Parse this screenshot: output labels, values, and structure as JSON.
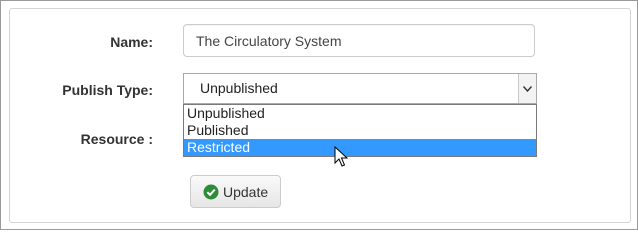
{
  "form": {
    "name_label": "Name:",
    "name_value": "The Circulatory System",
    "publish_type_label": "Publish Type:",
    "publish_type_value": "Unpublished",
    "resource_label": "Resource :",
    "options": [
      "Unpublished",
      "Published",
      "Restricted"
    ],
    "highlighted_option": "Restricted",
    "update_label": "Update"
  },
  "icons": {
    "dropdown_arrow": "chevron-down-icon",
    "update": "check-circle-icon",
    "cursor": "mouse-pointer-icon"
  },
  "colors": {
    "highlight": "#3399ff",
    "success_icon": "#2e8b3a"
  }
}
